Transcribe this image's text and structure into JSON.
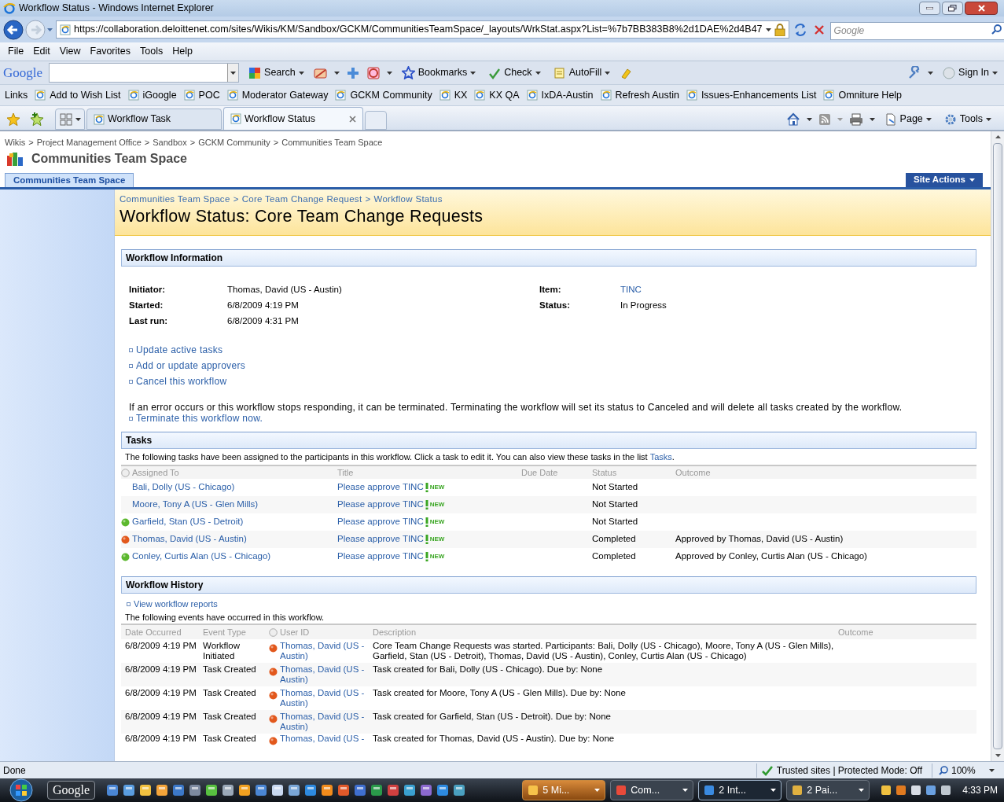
{
  "window": {
    "title": "Workflow Status - Windows Internet Explorer"
  },
  "address_bar": {
    "url": "https://collaboration.deloittenet.com/sites/Wikis/KM/Sandbox/GCKM/CommunitiesTeamSpace/_layouts/WrkStat.aspx?List=%7b7BB383B8%2d1DAE%2d4B47"
  },
  "search_box": {
    "placeholder": "Google"
  },
  "menu": [
    "File",
    "Edit",
    "View",
    "Favorites",
    "Tools",
    "Help"
  ],
  "google_toolbar": {
    "logo": "Google",
    "search": "Search",
    "bookmarks": "Bookmarks",
    "check": "Check",
    "autofill": "AutoFill",
    "sign_in": "Sign In"
  },
  "links_bar": {
    "label": "Links",
    "items": [
      "Add to Wish List",
      "iGoogle",
      "POC",
      "Moderator Gateway",
      "GCKM Community",
      "KX",
      "KX QA",
      "IxDA-Austin",
      "Refresh Austin",
      "Issues-Enhancements List",
      "Omniture Help"
    ]
  },
  "tabs": [
    {
      "label": "Workflow Task",
      "selected": false
    },
    {
      "label": "Workflow Status",
      "selected": true
    }
  ],
  "command_bar": {
    "page": "Page",
    "tools": "Tools"
  },
  "page": {
    "separator": ">",
    "breadcrumb": [
      "Wikis",
      "Project Management Office",
      "Sandbox",
      "GCKM Community",
      "Communities Team Space"
    ],
    "site_title": "Communities Team Space",
    "top_nav": [
      {
        "label": "Communities Team Space",
        "selected": true
      }
    ],
    "site_actions": "Site Actions",
    "title_breadcrumb": [
      "Communities Team Space",
      "Core Team Change Request",
      "Workflow Status"
    ],
    "title": "Workflow Status: Core Team Change Requests",
    "workflow_information": {
      "heading": "Workflow Information",
      "fields_left": [
        {
          "label": "Initiator:",
          "value": "Thomas, David (US - Austin)",
          "kind": "text"
        },
        {
          "label": "Started:",
          "value": "6/8/2009 4:19 PM",
          "kind": "text"
        },
        {
          "label": "Last run:",
          "value": "6/8/2009 4:31 PM",
          "kind": "text"
        }
      ],
      "fields_right": [
        {
          "label": "Item:",
          "value": "TINC",
          "kind": "link"
        },
        {
          "label": "Status:",
          "value": "In Progress",
          "kind": "text"
        }
      ],
      "actions": [
        "Update active tasks",
        "Add or update approvers",
        "Cancel this workflow"
      ],
      "note": "If an error occurs or this workflow stops responding, it can be terminated. Terminating the workflow will set its status to Canceled and will delete all tasks created by the workflow.",
      "terminate_link": "Terminate this workflow now."
    },
    "tasks": {
      "heading": "Tasks",
      "intro": "The following tasks have been assigned to the participants in this workflow. Click a task to edit it. You can also view these tasks in the list",
      "intro_link": "Tasks",
      "intro_end": ".",
      "columns": [
        "Assigned To",
        "Title",
        "Due Date",
        "Status",
        "Outcome"
      ],
      "rows": [
        {
          "assigned_to": "Bali, Dolly (US - Chicago)",
          "title": "Please approve TINC",
          "badge": "NEW",
          "status": "Not Started"
        },
        {
          "assigned_to": "Moore, Tony A (US - Glen Mills)",
          "title": "Please approve TINC",
          "badge": "NEW",
          "status": "Not Started"
        },
        {
          "assigned_to": "Garfield, Stan (US - Detroit)",
          "color": "#5cb82e",
          "title": "Please approve TINC",
          "badge": "NEW",
          "status": "Not Started"
        },
        {
          "assigned_to": "Thomas, David (US - Austin)",
          "color": "#e2581c",
          "title": "Please approve TINC",
          "badge": "NEW",
          "status": "Completed",
          "outcome": "Approved by Thomas, David (US - Austin)"
        },
        {
          "assigned_to": "Conley, Curtis Alan (US - Chicago)",
          "color": "#5cb82e",
          "title": "Please approve TINC",
          "badge": "NEW",
          "status": "Completed",
          "outcome": "Approved by Conley, Curtis Alan (US - Chicago)"
        }
      ]
    },
    "workflow_history": {
      "heading": "Workflow History",
      "report_link": "View workflow reports",
      "intro": "The following events have occurred in this workflow.",
      "columns": [
        "Date Occurred",
        "Event Type",
        "User ID",
        "Description",
        "Outcome"
      ],
      "rows": [
        {
          "date": "6/8/2009 4:19 PM",
          "event": "Workflow Initiated",
          "user": "Thomas, David (US - Austin)",
          "color": "#e2581c",
          "description": "Core Team Change Requests was started.  Participants: Bali, Dolly (US - Chicago), Moore, Tony A (US - Glen Mills), Garfield, Stan (US - Detroit), Thomas, David (US - Austin), Conley, Curtis Alan (US - Chicago)"
        },
        {
          "date": "6/8/2009 4:19 PM",
          "event": "Task Created",
          "user": "Thomas, David (US - Austin)",
          "color": "#e2581c",
          "description": "Task created for Bali, Dolly (US - Chicago).  Due by: None"
        },
        {
          "date": "6/8/2009 4:19 PM",
          "event": "Task Created",
          "user": "Thomas, David (US - Austin)",
          "color": "#e2581c",
          "description": "Task created for Moore, Tony A (US - Glen Mills).  Due by: None"
        },
        {
          "date": "6/8/2009 4:19 PM",
          "event": "Task Created",
          "user": "Thomas, David (US - Austin)",
          "color": "#e2581c",
          "description": "Task created for Garfield, Stan (US - Detroit).  Due by: None"
        },
        {
          "date": "6/8/2009 4:19 PM",
          "event": "Task Created",
          "user": "Thomas, David (US -",
          "color": "#e2581c",
          "description": "Task created for Thomas, David (US - Austin).  Due by: None"
        }
      ]
    }
  },
  "status_bar": {
    "text": "Done",
    "zone": "Trusted sites | Protected Mode: Off",
    "zoom": "100%"
  },
  "taskbar": {
    "search": "Google",
    "buttons": [
      {
        "label": "5 Mi...",
        "selected": false,
        "flashing": true
      },
      {
        "label": "Com...",
        "selected": false,
        "flashing": false
      },
      {
        "label": "2 Int...",
        "selected": true,
        "flashing": false
      },
      {
        "label": "2 Pai...",
        "selected": false,
        "flashing": false
      }
    ],
    "clock": "4:33 PM"
  }
}
